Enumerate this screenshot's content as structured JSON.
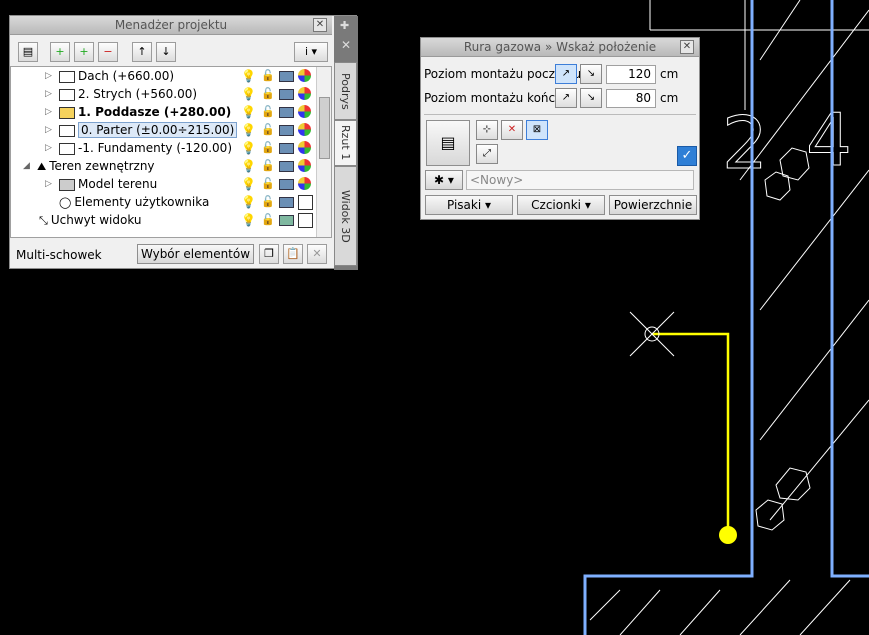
{
  "project_manager": {
    "title": "Menadżer projektu",
    "tree": [
      {
        "label": "Dach (+660.00)",
        "bold": false
      },
      {
        "label": "2. Strych (+560.00)",
        "bold": false
      },
      {
        "label": "1. Poddasze (+280.00)",
        "bold": true
      },
      {
        "label": "0. Parter (±0.00÷215.00)",
        "bold": false,
        "selected": true
      },
      {
        "label": "-1. Fundamenty (-120.00)",
        "bold": false
      },
      {
        "label": "Teren zewnętrzny",
        "bold": false
      },
      {
        "label": "Model terenu",
        "bold": false
      },
      {
        "label": "Elementy użytkownika",
        "bold": false
      },
      {
        "label": "Uchwyt widoku",
        "bold": false
      }
    ],
    "multi_clipboard_label": "Multi-schowek",
    "selection_button": "Wybór elementów",
    "side_tabs": [
      "Podrys",
      "Rzut 1",
      "Widok 3D"
    ]
  },
  "pipe_dialog": {
    "title": "Rura gazowa » Wskaż położenie",
    "start_label": "Poziom montażu początku",
    "start_value": "120",
    "end_label": "Poziom montażu końca",
    "end_value": "80",
    "unit": "cm",
    "style_placeholder": "<Nowy>",
    "pens_button": "Pisaki",
    "fonts_button": "Czcionki",
    "surfaces_button": "Powierzchnie"
  },
  "canvas": {
    "room_label_left": "2",
    "room_label_right": "4",
    "pipe_color": "#ffff00",
    "wall_color": "#7fb0ff"
  }
}
